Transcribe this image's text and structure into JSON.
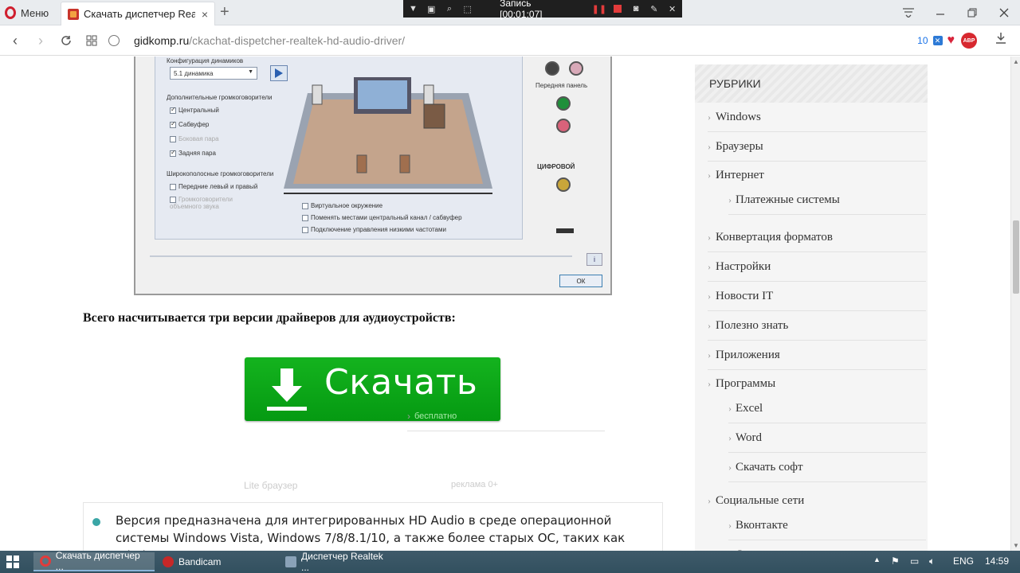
{
  "browser": {
    "menu_label": "Меню",
    "tab_title": "Скачать диспетчер Realtek",
    "tab_close": "×",
    "new_tab": "+",
    "url_host": "gidkomp.ru",
    "url_path": "/ckachat-dispetcher-realtek-hd-audio-driver/",
    "badge_count": "10",
    "abp_label": "ABP"
  },
  "recorder": {
    "status": "Запись [00:01:07]"
  },
  "embedded_screenshot": {
    "speaker_config_label": "Конфигурация динамиков",
    "speaker_config_value": "5.1 динамика",
    "additional_speakers_label": "Дополнительные громкоговорители",
    "options": [
      {
        "label": "Центральный",
        "checked": true,
        "disabled": false
      },
      {
        "label": "Сабвуфер",
        "checked": true,
        "disabled": false
      },
      {
        "label": "Боковая пара",
        "checked": false,
        "disabled": true
      },
      {
        "label": "Задняя пара",
        "checked": true,
        "disabled": false
      }
    ],
    "wideband_label": "Широкополосные громкоговорители",
    "wideband_options": [
      {
        "label": "Передние левый и правый",
        "checked": false,
        "disabled": false
      },
      {
        "label": "Громкоговорители объемного звука",
        "checked": false,
        "disabled": true
      }
    ],
    "bottom_options": [
      "Виртуальное окружение",
      "Поменять местами центральный канал / сабвуфер",
      "Подключение управления низкими частотами"
    ],
    "front_panel_label": "Передняя панель",
    "digital_label": "ЦИФРОВОЙ",
    "ok_label": "ОК",
    "info_label": "i"
  },
  "article": {
    "intro": "Всего насчитывается три версии драйверов для аудиоустройств:",
    "download_label": "Скачать",
    "download_sub": "бесплатно",
    "ad_left": "Lite браузер",
    "ad_right": "реклама 0+",
    "version_text": "Версия предназначена для интегрированных HD Audio в среде операционной системы Windows Vista, Windows 7/8/8.1/10, а также более старых ОС, таких как Windows"
  },
  "sidebar": {
    "heading": "РУБРИКИ",
    "categories": [
      "Windows",
      "Браузеры",
      "Интернет",
      "Платежные системы",
      "Конвертация форматов",
      "Настройки",
      "Новости IT",
      "Полезно знать",
      "Приложения",
      "Программы",
      "Excel",
      "Word",
      "Скачать софт",
      "Социальные сети",
      "Вконтакте",
      "Одноклассники"
    ]
  },
  "taskbar": {
    "items": [
      "Скачать диспетчер ...",
      "Bandicam",
      "Диспетчер Realtek ..."
    ],
    "language": "ENG",
    "time": "14:59"
  },
  "colors": {
    "download_green": "#0ba617",
    "opera_red": "#d01f2e",
    "bullet_teal": "#3aa6a6"
  }
}
